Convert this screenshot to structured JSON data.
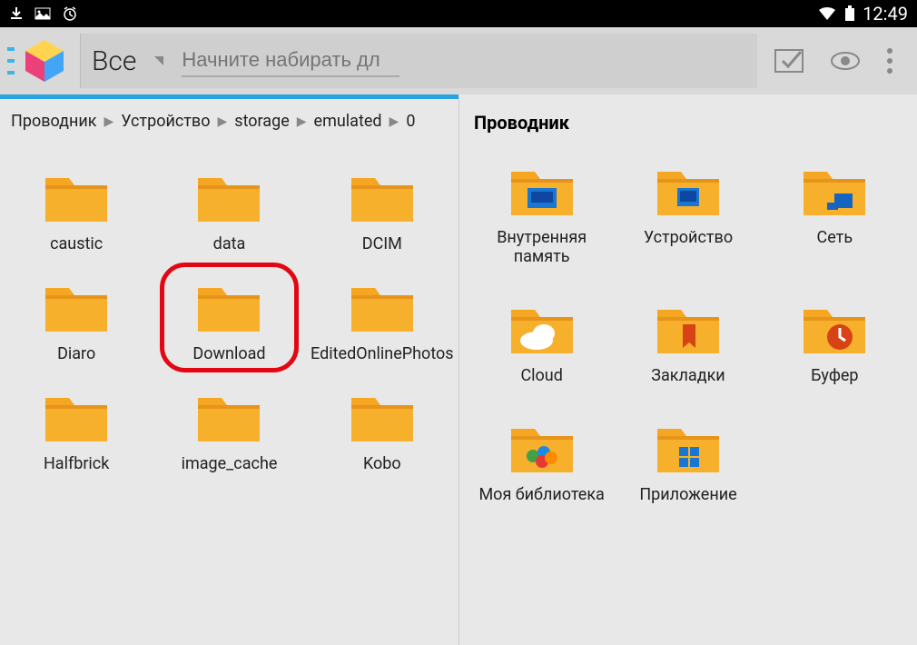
{
  "status": {
    "time": "12:49"
  },
  "toolbar": {
    "filter_label": "Все",
    "search_placeholder": "Начните набирать дл"
  },
  "breadcrumb": [
    "Проводник",
    "Устройство",
    "storage",
    "emulated",
    "0"
  ],
  "right_title": "Проводник",
  "left_items": [
    {
      "label": "caustic",
      "icon": "folder"
    },
    {
      "label": "data",
      "icon": "folder"
    },
    {
      "label": "DCIM",
      "icon": "folder"
    },
    {
      "label": "Diaro",
      "icon": "folder"
    },
    {
      "label": "Download",
      "icon": "folder",
      "highlight": true
    },
    {
      "label": "EditedOnlinePhotos",
      "icon": "folder"
    },
    {
      "label": "Halfbrick",
      "icon": "folder"
    },
    {
      "label": "image_cache",
      "icon": "folder"
    },
    {
      "label": "Kobo",
      "icon": "folder"
    }
  ],
  "right_items": [
    {
      "label": "Внутренняя память",
      "icon": "internal"
    },
    {
      "label": "Устройство",
      "icon": "device"
    },
    {
      "label": "Сеть",
      "icon": "network"
    },
    {
      "label": "Cloud",
      "icon": "cloud"
    },
    {
      "label": "Закладки",
      "icon": "bookmark"
    },
    {
      "label": "Буфер",
      "icon": "clock"
    },
    {
      "label": "Моя библиотека",
      "icon": "library"
    },
    {
      "label": "Приложение",
      "icon": "apps"
    }
  ]
}
